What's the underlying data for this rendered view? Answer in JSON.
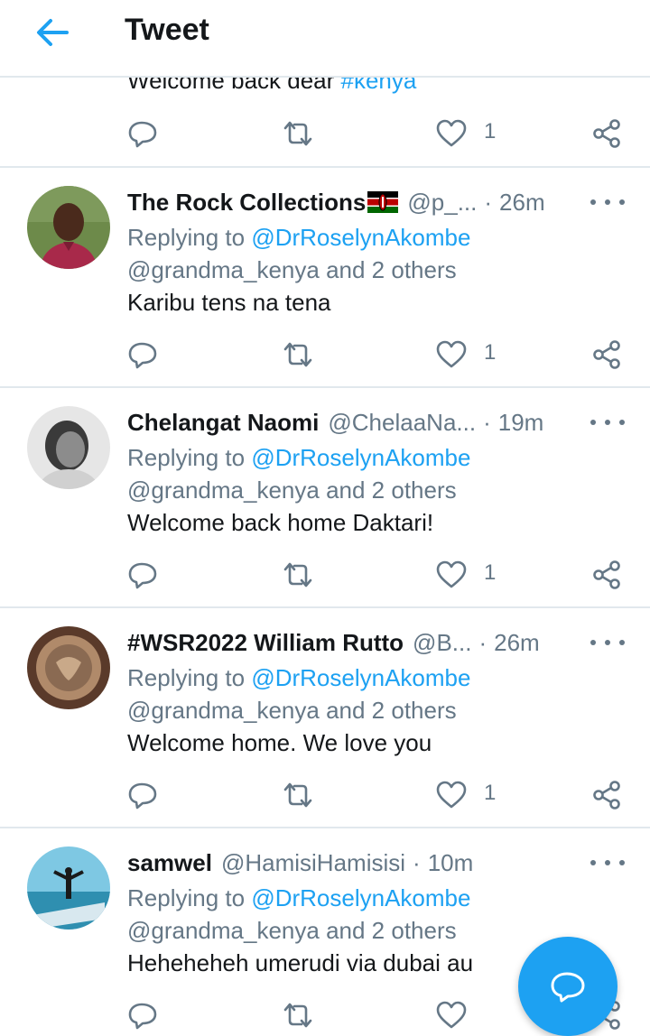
{
  "header": {
    "title": "Tweet"
  },
  "previous_tweet": {
    "text_prefix": "Welcome back dear ",
    "hashtag": "#kenya",
    "like_count": "1"
  },
  "tweets": [
    {
      "name": "The Rock Collections",
      "flag": "kenya-flag",
      "handle": "@p_...",
      "time": "26m",
      "replying_prefix": "Replying to ",
      "reply_to_1": "@DrRoselynAkombe",
      "reply_to_2": "@grandma_kenya and 2 others",
      "text": "Karibu tens na tena",
      "like_count": "1"
    },
    {
      "name": "Chelangat Naomi",
      "handle": "@ChelaaNa...",
      "time": "19m",
      "replying_prefix": "Replying to ",
      "reply_to_1": "@DrRoselynAkombe",
      "reply_to_2": "@grandma_kenya and 2 others",
      "text": "Welcome back home Daktari!",
      "like_count": "1"
    },
    {
      "name": "#WSR2022 William Rutto",
      "handle": "@B...",
      "time": "26m",
      "replying_prefix": "Replying to ",
      "reply_to_1": "@DrRoselynAkombe",
      "reply_to_2": "@grandma_kenya and 2 others",
      "text": "Welcome home. We love you",
      "like_count": "1"
    },
    {
      "name": "samwel",
      "handle": "@HamisiHamisisi",
      "time": "10m",
      "replying_prefix": "Replying to ",
      "reply_to_1": "@DrRoselynAkombe",
      "reply_to_2": "@grandma_kenya and 2 others",
      "text": "Heheheheh umerudi via dubai au",
      "like_count": ""
    }
  ],
  "dot_separator": "·",
  "colors": {
    "accent": "#1da1f2",
    "muted": "#657786",
    "divider": "#e1e8ed"
  },
  "icons": [
    "back-arrow-icon",
    "reply-icon",
    "retweet-icon",
    "like-icon",
    "share-icon",
    "more-icon",
    "compose-reply-icon"
  ]
}
